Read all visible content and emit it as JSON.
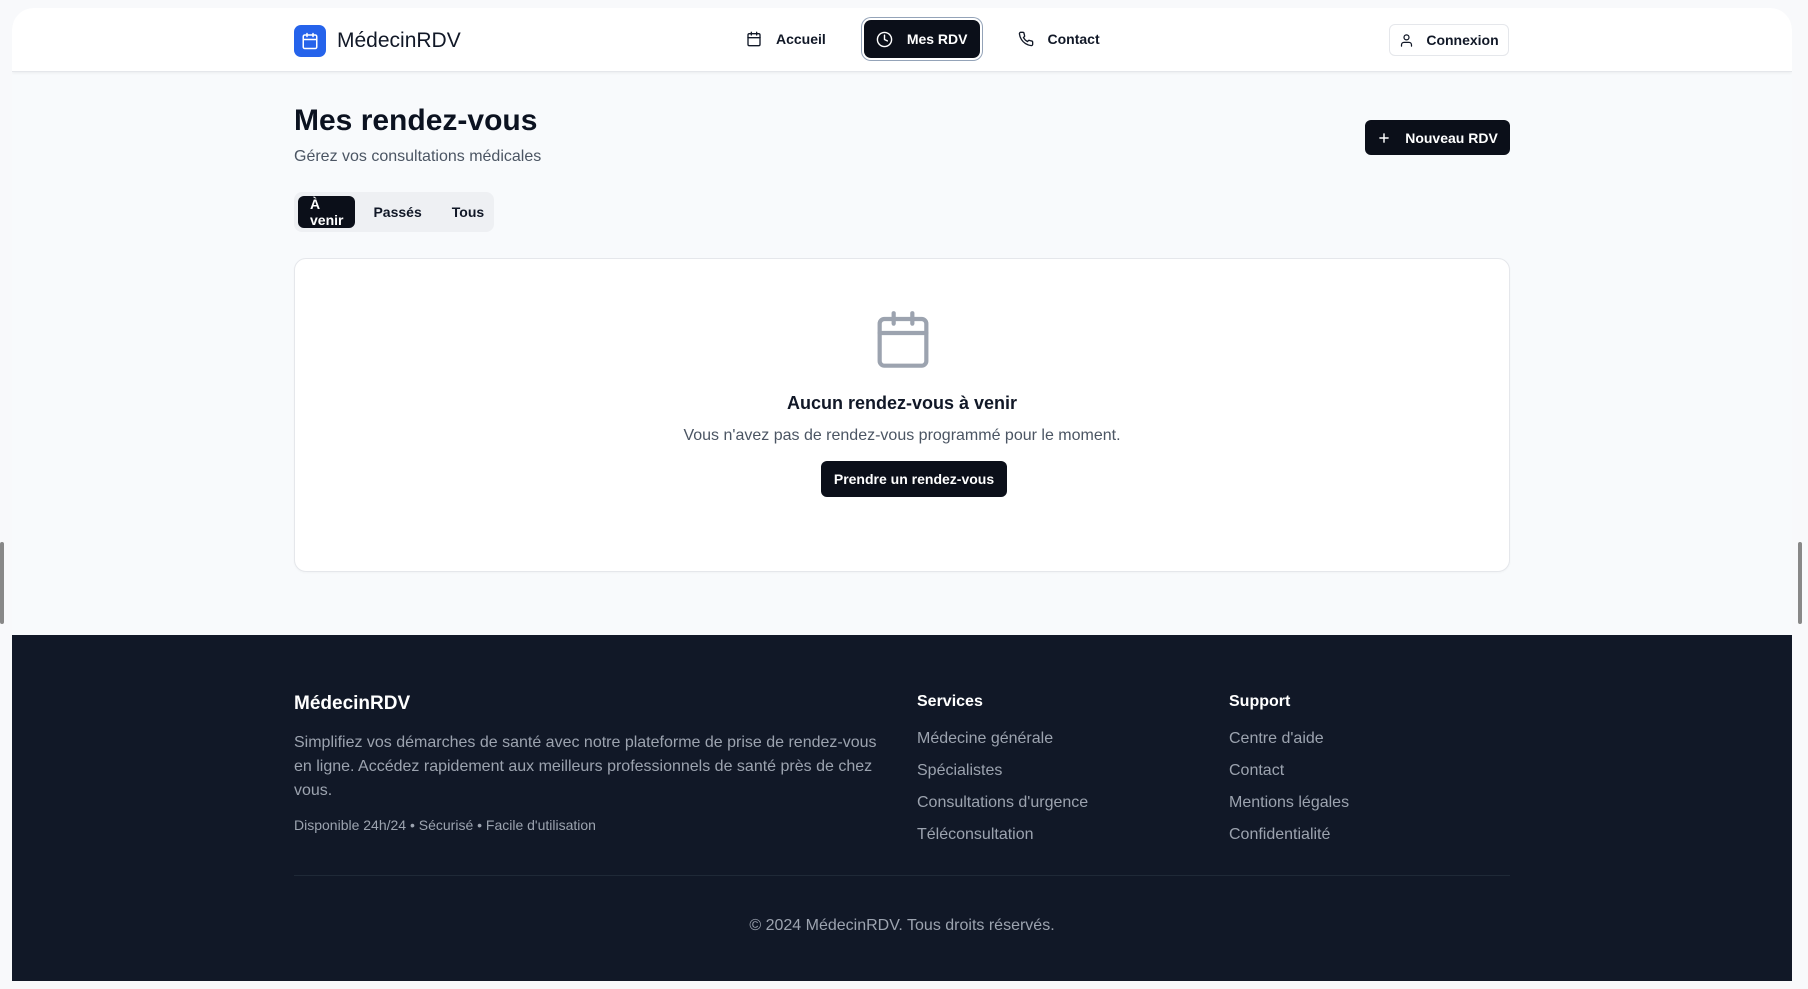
{
  "header": {
    "brand": "MédecinRDV",
    "nav": [
      {
        "label": "Accueil",
        "icon": "calendar-icon"
      },
      {
        "label": "Mes RDV",
        "icon": "clock-icon",
        "active": true
      },
      {
        "label": "Contact",
        "icon": "phone-icon"
      }
    ],
    "login_label": "Connexion"
  },
  "main": {
    "title": "Mes rendez-vous",
    "subtitle": "Gérez vos consultations médicales",
    "new_button": "Nouveau RDV",
    "tabs": [
      {
        "label": "À venir",
        "active": true
      },
      {
        "label": "Passés"
      },
      {
        "label": "Tous"
      }
    ],
    "empty": {
      "title": "Aucun rendez-vous à venir",
      "text": "Vous n'avez pas de rendez-vous programmé pour le moment.",
      "button": "Prendre un rendez-vous"
    }
  },
  "footer": {
    "brand": "MédecinRDV",
    "description": "Simplifiez vos démarches de santé avec notre plateforme de prise de rendez-vous en ligne. Accédez rapidement aux meilleurs professionnels de santé près de chez vous.",
    "tagline": "Disponible 24h/24 • Sécurisé • Facile d'utilisation",
    "services_title": "Services",
    "services": [
      "Médecine générale",
      "Spécialistes",
      "Consultations d'urgence",
      "Téléconsultation"
    ],
    "support_title": "Support",
    "support": [
      "Centre d'aide",
      "Contact",
      "Mentions légales",
      "Confidentialité"
    ],
    "copyright": "© 2024 MédecinRDV. Tous droits réservés."
  },
  "colors": {
    "brand_blue": "#2563eb",
    "primary_dark": "#0b0f19",
    "footer_bg": "#111827"
  }
}
